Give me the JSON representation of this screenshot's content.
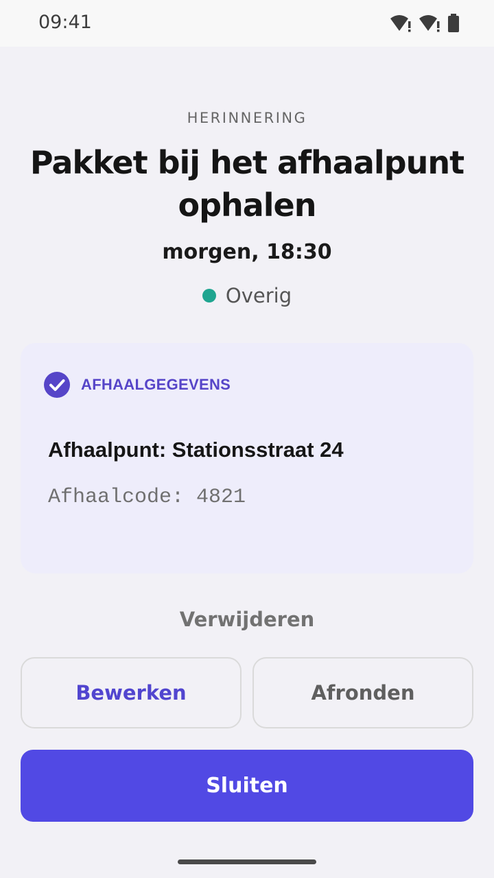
{
  "status_bar": {
    "time": "09:41",
    "icons": [
      "wifi-alert-icon",
      "wifi-alert-icon",
      "battery-icon"
    ]
  },
  "reminder": {
    "eyebrow": "HERINNERING",
    "title": "Pakket bij het afhaalpunt ophalen",
    "when": "morgen, 18:30",
    "category": {
      "label": "Overig",
      "color": "#1fa590"
    }
  },
  "details_card": {
    "heading": "AFHAALGEGEVENS",
    "icon": "check-circle-icon",
    "line1": "Afhaalpunt: Stationsstraat 24",
    "line2": "Afhaalcode: 4821"
  },
  "actions": {
    "delete_label": "Verwijderen",
    "edit_label": "Bewerken",
    "complete_label": "Afronden",
    "close_label": "Sluiten"
  },
  "colors": {
    "accent": "#5149e4",
    "accent_text": "#5145cf",
    "card_bg": "#eeedfb",
    "background": "#f2f1f6"
  }
}
